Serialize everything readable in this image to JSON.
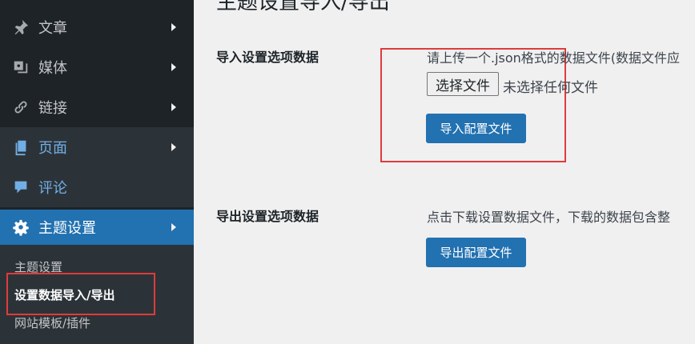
{
  "sidebar": {
    "items": [
      {
        "label": "文章",
        "icon": "pin-icon"
      },
      {
        "label": "媒体",
        "icon": "media-icon"
      },
      {
        "label": "链接",
        "icon": "link-icon"
      },
      {
        "label": "页面",
        "icon": "page-icon"
      },
      {
        "label": "评论",
        "icon": "comment-icon"
      },
      {
        "label": "主题设置",
        "icon": "gear-icon"
      }
    ],
    "submenu": [
      {
        "label": "主题设置"
      },
      {
        "label": "设置数据导入/导出"
      },
      {
        "label": "网站模板/插件"
      }
    ]
  },
  "main": {
    "title": "主题设置导入/导出",
    "import": {
      "label": "导入设置选项数据",
      "description": "请上传一个.json格式的数据文件(数据文件应",
      "file_button": "选择文件",
      "file_status": "未选择任何文件",
      "button": "导入配置文件"
    },
    "export": {
      "label": "导出设置选项数据",
      "description": "点击下载设置数据文件，下载的数据包含整",
      "button": "导出配置文件"
    }
  },
  "colors": {
    "sidebar_bg": "#1d2327",
    "submenu_bg": "#2c3338",
    "accent": "#2271b1",
    "highlight_text": "#72aee6",
    "annotation_red": "#e03b3b"
  }
}
